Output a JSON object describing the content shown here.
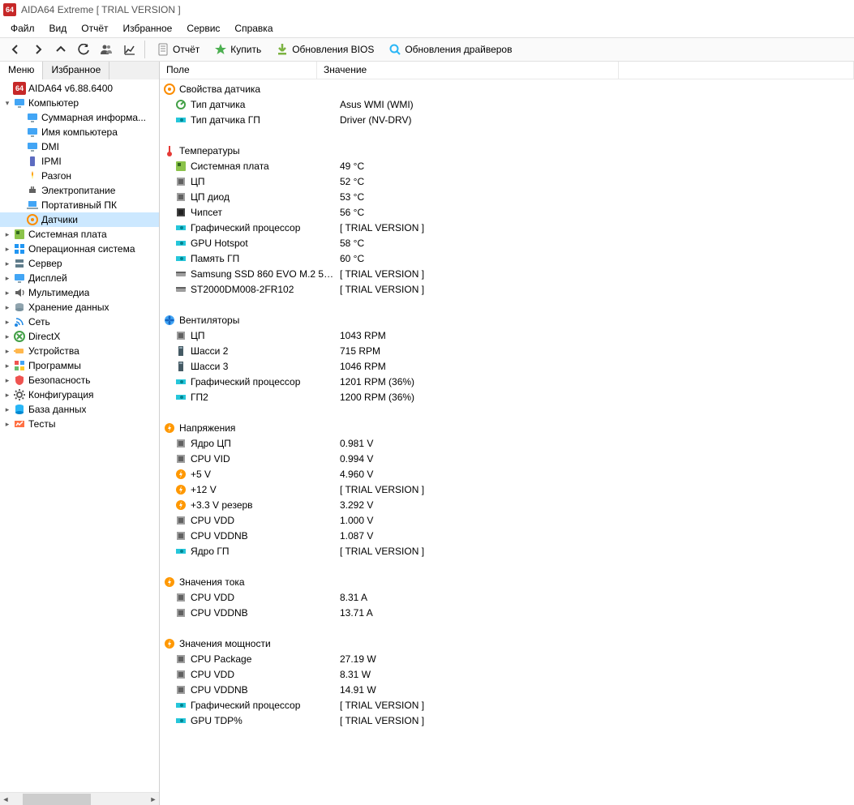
{
  "title": "AIDA64 Extreme  [ TRIAL VERSION ]",
  "app_logo": "64",
  "menubar": [
    "Файл",
    "Вид",
    "Отчёт",
    "Избранное",
    "Сервис",
    "Справка"
  ],
  "toolbar": {
    "report": "Отчёт",
    "buy": "Купить",
    "bios": "Обновления BIOS",
    "drivers": "Обновления драйверов"
  },
  "left_tabs": {
    "menu": "Меню",
    "fav": "Избранное"
  },
  "tree": {
    "root": "AIDA64 v6.88.6400",
    "computer": {
      "label": "Компьютер",
      "children": [
        "Суммарная информа...",
        "Имя компьютера",
        "DMI",
        "IPMI",
        "Разгон",
        "Электропитание",
        "Портативный ПК",
        "Датчики"
      ]
    },
    "rest": [
      "Системная плата",
      "Операционная система",
      "Сервер",
      "Дисплей",
      "Мультимедиа",
      "Хранение данных",
      "Сеть",
      "DirectX",
      "Устройства",
      "Программы",
      "Безопасность",
      "Конфигурация",
      "База данных",
      "Тесты"
    ]
  },
  "columns": {
    "field": "Поле",
    "value": "Значение"
  },
  "groups": [
    {
      "title": "Свойства датчика",
      "icon": "sensor",
      "items": [
        {
          "icon": "probe",
          "field": "Тип датчика",
          "value": "Asus WMI  (WMI)"
        },
        {
          "icon": "gpu",
          "field": "Тип датчика ГП",
          "value": "Driver  (NV-DRV)"
        }
      ]
    },
    {
      "title": "Температуры",
      "icon": "thermo",
      "items": [
        {
          "icon": "mobo",
          "field": "Системная плата",
          "value": "49 °C"
        },
        {
          "icon": "cpu",
          "field": "ЦП",
          "value": "52 °C"
        },
        {
          "icon": "cpu",
          "field": "ЦП диод",
          "value": "53 °C"
        },
        {
          "icon": "chip",
          "field": "Чипсет",
          "value": "56 °C"
        },
        {
          "icon": "gpu",
          "field": "Графический процессор",
          "value": "[ TRIAL VERSION ]"
        },
        {
          "icon": "gpu",
          "field": "GPU Hotspot",
          "value": "58 °C"
        },
        {
          "icon": "gpu",
          "field": "Память ГП",
          "value": "60 °C"
        },
        {
          "icon": "ssd",
          "field": "Samsung SSD 860 EVO M.2 5…",
          "value": "[ TRIAL VERSION ]"
        },
        {
          "icon": "ssd",
          "field": "ST2000DM008-2FR102",
          "value": "[ TRIAL VERSION ]"
        }
      ]
    },
    {
      "title": "Вентиляторы",
      "icon": "fan",
      "items": [
        {
          "icon": "cpu",
          "field": "ЦП",
          "value": "1043 RPM"
        },
        {
          "icon": "case",
          "field": "Шасси 2",
          "value": "715 RPM"
        },
        {
          "icon": "case",
          "field": "Шасси 3",
          "value": "1046 RPM"
        },
        {
          "icon": "gpu",
          "field": "Графический процессор",
          "value": "1201 RPM  (36%)"
        },
        {
          "icon": "gpu",
          "field": "ГП2",
          "value": "1200 RPM  (36%)"
        }
      ]
    },
    {
      "title": "Напряжения",
      "icon": "volt",
      "items": [
        {
          "icon": "cpu",
          "field": "Ядро ЦП",
          "value": "0.981 V"
        },
        {
          "icon": "cpu",
          "field": "CPU VID",
          "value": "0.994 V"
        },
        {
          "icon": "volt",
          "field": "+5 V",
          "value": "4.960 V"
        },
        {
          "icon": "volt",
          "field": "+12 V",
          "value": "[ TRIAL VERSION ]"
        },
        {
          "icon": "volt",
          "field": "+3.3 V резерв",
          "value": "3.292 V"
        },
        {
          "icon": "cpu",
          "field": "CPU VDD",
          "value": "1.000 V"
        },
        {
          "icon": "cpu",
          "field": "CPU VDDNB",
          "value": "1.087 V"
        },
        {
          "icon": "gpu",
          "field": "Ядро ГП",
          "value": "[ TRIAL VERSION ]"
        }
      ]
    },
    {
      "title": "Значения тока",
      "icon": "volt",
      "items": [
        {
          "icon": "cpu",
          "field": "CPU VDD",
          "value": "8.31 A"
        },
        {
          "icon": "cpu",
          "field": "CPU VDDNB",
          "value": "13.71 A"
        }
      ]
    },
    {
      "title": "Значения мощности",
      "icon": "volt",
      "items": [
        {
          "icon": "cpu",
          "field": "CPU Package",
          "value": "27.19 W"
        },
        {
          "icon": "cpu",
          "field": "CPU VDD",
          "value": "8.31 W"
        },
        {
          "icon": "cpu",
          "field": "CPU VDDNB",
          "value": "14.91 W"
        },
        {
          "icon": "gpu",
          "field": "Графический процессор",
          "value": "[ TRIAL VERSION ]"
        },
        {
          "icon": "gpu",
          "field": "GPU TDP%",
          "value": "[ TRIAL VERSION ]"
        }
      ]
    }
  ]
}
